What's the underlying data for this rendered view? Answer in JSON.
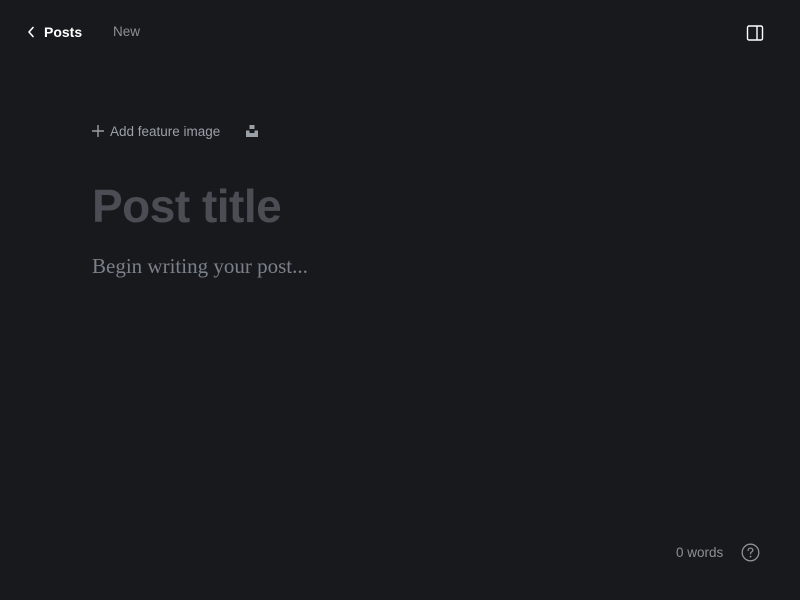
{
  "header": {
    "back_label": "Posts",
    "status": "New",
    "icons": {
      "back": "chevron-left-icon",
      "sidebar_toggle": "sidebar-toggle-icon"
    }
  },
  "editor": {
    "add_feature_image_label": "Add feature image",
    "title_placeholder": "Post title",
    "body_placeholder": "Begin writing your post...",
    "icons": {
      "add": "plus-icon",
      "unsplash": "unsplash-icon"
    }
  },
  "footer": {
    "word_count": "0 words",
    "icons": {
      "help": "help-icon"
    }
  },
  "colors": {
    "background": "#18191d",
    "title_placeholder": "#4a4d53",
    "body_placeholder": "#7a808a",
    "muted_text": "#8c9097"
  }
}
